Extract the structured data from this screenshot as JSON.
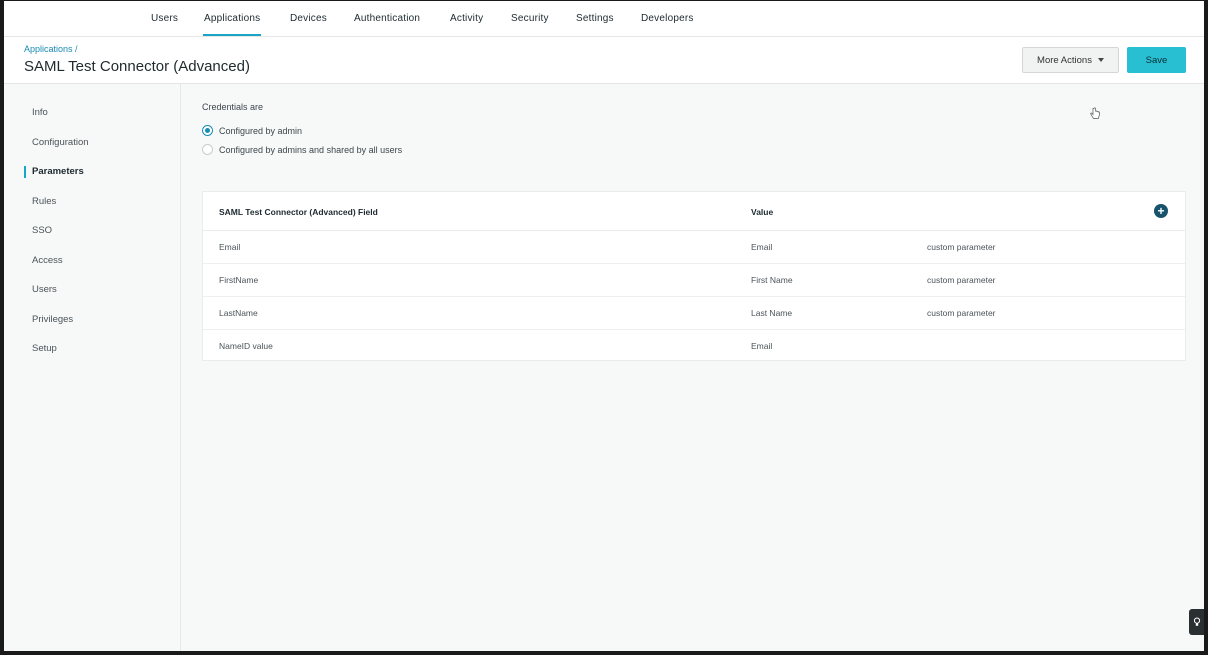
{
  "nav": {
    "tabs": [
      {
        "label": "Users"
      },
      {
        "label": "Applications"
      },
      {
        "label": "Devices"
      },
      {
        "label": "Authentication"
      },
      {
        "label": "Activity"
      },
      {
        "label": "Security"
      },
      {
        "label": "Settings"
      },
      {
        "label": "Developers"
      }
    ],
    "active": "Applications"
  },
  "header": {
    "breadcrumb": "Applications /",
    "title": "SAML Test Connector (Advanced)",
    "more_actions_label": "More Actions",
    "save_label": "Save"
  },
  "sidebar": {
    "items": [
      {
        "label": "Info"
      },
      {
        "label": "Configuration"
      },
      {
        "label": "Parameters"
      },
      {
        "label": "Rules"
      },
      {
        "label": "SSO"
      },
      {
        "label": "Access"
      },
      {
        "label": "Users"
      },
      {
        "label": "Privileges"
      },
      {
        "label": "Setup"
      }
    ],
    "active": "Parameters"
  },
  "credentials": {
    "label": "Credentials are",
    "options": [
      {
        "label": "Configured by admin",
        "selected": true
      },
      {
        "label": "Configured by admins and shared by all users",
        "selected": false
      }
    ]
  },
  "table": {
    "columns": [
      "SAML Test Connector (Advanced) Field",
      "Value"
    ],
    "rows": [
      {
        "field": "Email",
        "value": "Email",
        "note": "custom parameter"
      },
      {
        "field": "FirstName",
        "value": "First Name",
        "note": "custom parameter"
      },
      {
        "field": "LastName",
        "value": "Last Name",
        "note": "custom parameter"
      },
      {
        "field": "NameID value",
        "value": "Email",
        "note": ""
      }
    ]
  },
  "colors": {
    "accent": "#1aa5c8",
    "save_button": "#27bfd1",
    "add_button": "#17536a"
  },
  "icons": {
    "add": "plus-circle-icon",
    "cursor": "hand-pointer-icon",
    "help": "lightbulb-icon"
  }
}
